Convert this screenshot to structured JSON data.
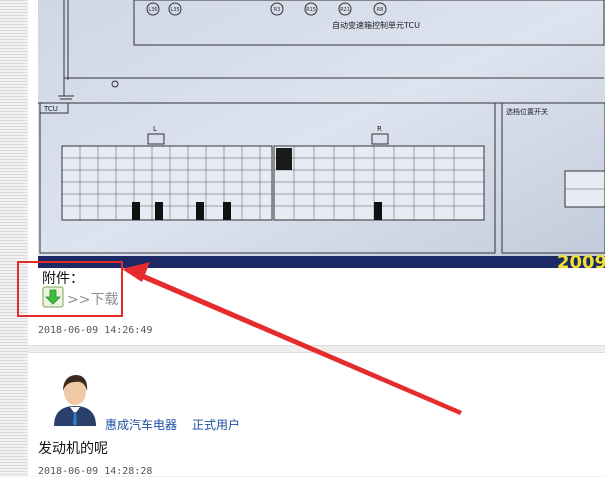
{
  "post1": {
    "photo": {
      "tcu_caption": "自动变速箱控制单元TCU",
      "pin_labels_top": [
        "L36",
        "L35",
        "R3",
        "R15",
        "R21",
        "R8"
      ],
      "tcu_box_label": "TCU",
      "selector_label": "选档位置开关",
      "conn_left": "L",
      "conn_right": "R",
      "year_watermark": "2009"
    },
    "attachment_label": "附件：",
    "download_text": ">>下载",
    "timestamp": "2018-06-09 14:26:49"
  },
  "post2": {
    "username": "惠成汽车电器",
    "role": "正式用户",
    "content": "发动机的呢",
    "timestamp": "2018-06-09 14:28:28"
  },
  "colors": {
    "annotation": "#e52b2b",
    "link": "#1f4ea3"
  },
  "icons": [
    "download-arrow-icon",
    "user-avatar-icon"
  ]
}
